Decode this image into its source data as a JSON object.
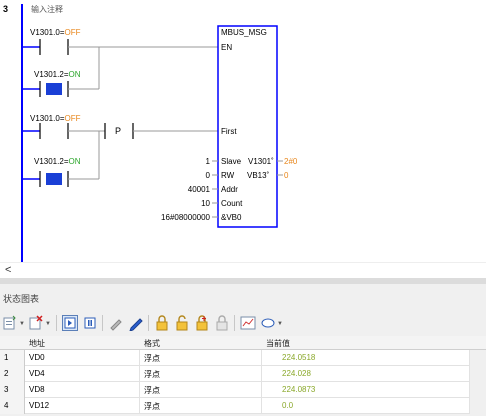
{
  "ladder": {
    "network_number": "3",
    "comment": "输入注释",
    "contacts": [
      {
        "name": "V1301.0",
        "state": "OFF"
      },
      {
        "name": "V1301.2",
        "state": "ON"
      },
      {
        "name": "V1301.0",
        "state": "OFF"
      },
      {
        "name": "V1301.2",
        "state": "ON"
      }
    ],
    "p_contact": "P",
    "block": {
      "title": "MBUS_MSG",
      "pins": {
        "en": "EN",
        "first": "First",
        "slave": "Slave",
        "rw": "RW",
        "addr": "Addr",
        "count": "Count",
        "data_ptr": "&VB0"
      },
      "inputs": {
        "slave": "1",
        "rw": "0",
        "addr": "40001",
        "count": "10",
        "data_ptr": "16#08000000"
      },
      "outputs": {
        "done_label": "V1301˚",
        "done_value": "2#0",
        "error_label": "VB13˚",
        "error_value": "0"
      }
    }
  },
  "status_chart": {
    "title": "状态图表",
    "toolbar_icons": [
      "insert-row-icon",
      "delete-row-icon",
      "start-monitor-icon",
      "pause-icon",
      "write-icon",
      "pencil-icon",
      "lock-icon",
      "unlock-icon",
      "force-icon",
      "unforce-all-icon",
      "trend-chart-icon",
      "options-icon"
    ],
    "columns": [
      "地址",
      "格式",
      "当前值"
    ],
    "rows": [
      {
        "num": "1",
        "address": "VD0",
        "format": "浮点",
        "value": "224.0518"
      },
      {
        "num": "2",
        "address": "VD4",
        "format": "浮点",
        "value": "224.028"
      },
      {
        "num": "3",
        "address": "VD8",
        "format": "浮点",
        "value": "224.0873"
      },
      {
        "num": "4",
        "address": "VD12",
        "format": "浮点",
        "value": "0.0"
      }
    ]
  },
  "colors": {
    "rail_blue": "#0000ff",
    "contact_on_blue": "#1a3fd6",
    "state_on_green": "#2aa52a",
    "state_off_orange": "#e8861a",
    "value_green": "#8aa82a"
  }
}
